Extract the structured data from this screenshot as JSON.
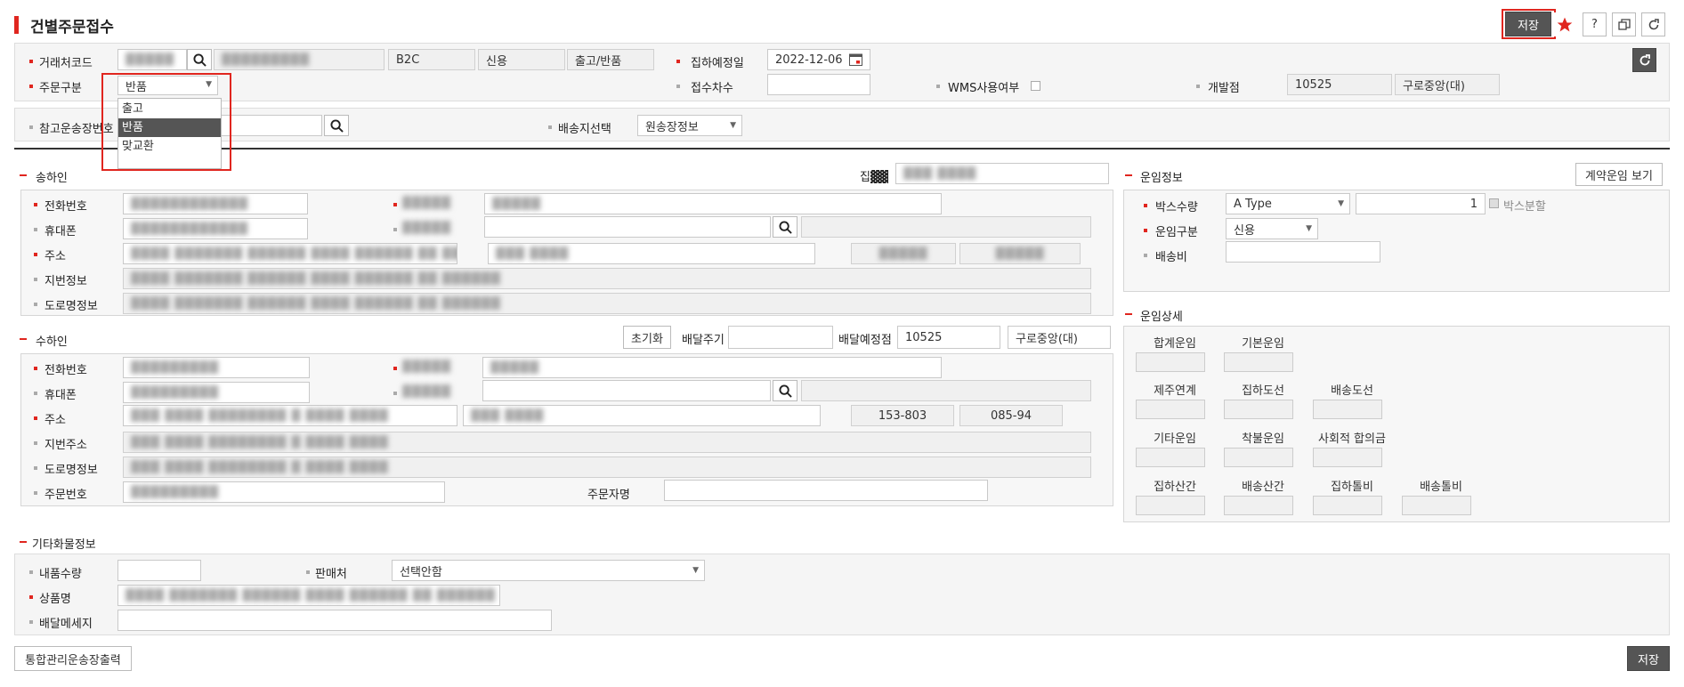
{
  "page": {
    "title": "건별주문접수"
  },
  "toolbar": {
    "save": "저장",
    "help": "?"
  },
  "header": {
    "customer_code_label": "거래처코드",
    "customer_code_value": "▓▓▓▓▓",
    "customer_name_value": "▓▓▓▓▓▓▓▓▓",
    "customer_type": "B2C",
    "payment_type": "신용",
    "shipping_type": "출고/반품",
    "pickup_date_label": "집하예정일",
    "pickup_date_value": "2022-12-06",
    "order_type_label": "주문구분",
    "order_type_value": "반품",
    "receipt_count_label": "접수차수",
    "wms_label": "WMS사용여부",
    "branch_label": "개발점",
    "branch_code": "10525",
    "branch_name": "구로중앙(대)",
    "ref_invoice_label": "참고운송장번호",
    "ship_select_label": "배송지선택",
    "ship_select_value": "원송장정보"
  },
  "dropdown": {
    "items": [
      "출고",
      "반품",
      "맞교환"
    ]
  },
  "sender": {
    "section": "송하인",
    "pickup_label": "집▓▓",
    "phone_label": "전화번호",
    "mobile_label": "휴대폰",
    "address_label": "주소",
    "jibun_label": "지번정보",
    "road_label": "도로명정보",
    "blur1": "▓▓▓▓▓▓▓▓▓▓▓▓",
    "blur2": "▓▓▓▓ ▓▓▓▓▓▓▓ ▓▓▓▓▓▓ ▓▓▓▓ ▓▓▓▓▓▓ ▓▓ ▓▓▓▓▓▓",
    "blur3": "▓▓▓▓▓",
    "blur4": "▓▓▓ ▓▓▓▓"
  },
  "receiver": {
    "section": "수하인",
    "reset": "초기화",
    "cycle_label": "배달주기",
    "branch_label": "배달예정점",
    "branch_code": "10525",
    "branch_name": "구로중앙(대)",
    "phone_label": "전화번호",
    "mobile_label": "휴대폰",
    "address_label": "주소",
    "jibun_label": "지번주소",
    "road_label": "도로명정보",
    "order_no_label": "주문번호",
    "orderer_label": "주문자명",
    "zip1": "153-803",
    "zip2": "085-94",
    "blur1": "▓▓▓▓▓▓▓▓▓",
    "blur2": "▓▓▓ ▓▓▓▓ ▓▓▓▓▓▓▓▓ ▓ ▓▓▓▓ ▓▓▓▓"
  },
  "fare": {
    "section": "운임정보",
    "contract_btn": "계약운임 보기",
    "box_qty_label": "박스수량",
    "box_type": "A Type",
    "box_qty_value": "1",
    "box_split": "박스분할",
    "fare_type_label": "운임구분",
    "fare_type_value": "신용",
    "delivery_fee_label": "배송비"
  },
  "fare_detail": {
    "section": "운임상세",
    "labels": [
      "합계운임",
      "기본운임",
      "제주연계",
      "집하도선",
      "배송도선",
      "기타운임",
      "착불운임",
      "사회적 합의금",
      "집하산간",
      "배송산간",
      "집하톨비",
      "배송톨비"
    ]
  },
  "etc": {
    "section": "기타화물정보",
    "qty_label": "내품수량",
    "seller_label": "판매처",
    "seller_value": "선택안함",
    "product_label": "상품명",
    "message_label": "배달메세지"
  },
  "footer": {
    "print": "통합관리운송장출력",
    "save": "저장"
  }
}
